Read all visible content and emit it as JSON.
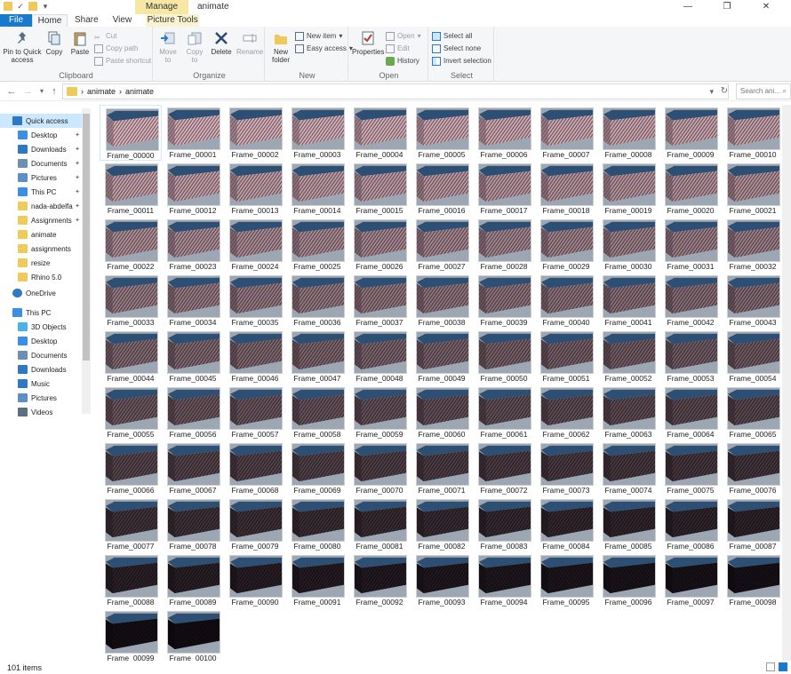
{
  "window": {
    "title": "animate",
    "contextual_tab": "Manage"
  },
  "tabs": [
    "File",
    "Home",
    "Share",
    "View",
    "Picture Tools"
  ],
  "ribbon": {
    "clipboard": {
      "label": "Clipboard",
      "pin": "Pin to Quick access",
      "copy": "Copy",
      "paste": "Paste",
      "cut": "Cut",
      "copy_path": "Copy path",
      "paste_shortcut": "Paste shortcut"
    },
    "organize": {
      "label": "Organize",
      "move_to": "Move to",
      "copy_to": "Copy to",
      "delete": "Delete",
      "rename": "Rename"
    },
    "new": {
      "label": "New",
      "new_folder": "New folder",
      "new_item": "New item",
      "easy_access": "Easy access"
    },
    "open": {
      "label": "Open",
      "properties": "Properties",
      "open": "Open",
      "edit": "Edit",
      "history": "History"
    },
    "select": {
      "label": "Select",
      "select_all": "Select all",
      "select_none": "Select none",
      "invert": "Invert selection"
    }
  },
  "address": {
    "crumbs": [
      "animate",
      "animate"
    ],
    "search_placeholder": "Search ani..."
  },
  "sidebar": [
    {
      "label": "Quick access",
      "icon": "star-icon",
      "selected": true
    },
    {
      "label": "Desktop",
      "icon": "desktop-icon",
      "pinned": true
    },
    {
      "label": "Downloads",
      "icon": "download-icon",
      "pinned": true
    },
    {
      "label": "Documents",
      "icon": "documents-icon",
      "pinned": true
    },
    {
      "label": "Pictures",
      "icon": "pictures-icon",
      "pinned": true
    },
    {
      "label": "This PC",
      "icon": "computer-icon",
      "pinned": true
    },
    {
      "label": "nada-abdelfa",
      "icon": "folder-icon",
      "pinned": true
    },
    {
      "label": "Assignments",
      "icon": "folder-icon",
      "pinned": true
    },
    {
      "label": "animate",
      "icon": "folder-icon"
    },
    {
      "label": "assignments",
      "icon": "folder-icon"
    },
    {
      "label": "resize",
      "icon": "folder-icon"
    },
    {
      "label": "Rhino 5.0",
      "icon": "folder-icon"
    },
    {
      "label": "OneDrive",
      "icon": "cloud-icon"
    },
    {
      "label": "This PC",
      "icon": "computer-icon"
    },
    {
      "label": "3D Objects",
      "icon": "cube-icon"
    },
    {
      "label": "Desktop",
      "icon": "desktop-icon"
    },
    {
      "label": "Documents",
      "icon": "documents-icon"
    },
    {
      "label": "Downloads",
      "icon": "download-icon"
    },
    {
      "label": "Music",
      "icon": "music-icon"
    },
    {
      "label": "Pictures",
      "icon": "pictures-icon"
    },
    {
      "label": "Videos",
      "icon": "video-icon"
    }
  ],
  "files": {
    "prefix": "Frame_",
    "count": 101
  },
  "status": {
    "items": "101 items"
  },
  "colors": {
    "accent": "#1979ca",
    "selection": "#cce8ff",
    "folder": "#f0c95c"
  }
}
